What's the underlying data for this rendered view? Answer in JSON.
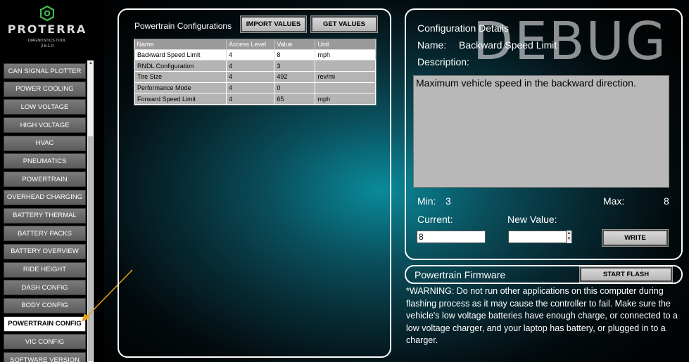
{
  "sidebar": {
    "brand": "PROTERRA",
    "tool_name": "DIAGNOSTICS TOOL",
    "version": "2.6.1.0",
    "items": [
      {
        "label": "CAN SIGNAL PLOTTER"
      },
      {
        "label": "POWER COOLING"
      },
      {
        "label": "LOW VOLTAGE"
      },
      {
        "label": "HIGH VOLTAGE"
      },
      {
        "label": "HVAC"
      },
      {
        "label": "PNEUMATICS"
      },
      {
        "label": "POWERTRAIN"
      },
      {
        "label": "OVERHEAD CHARGING"
      },
      {
        "label": "BATTERY THERMAL"
      },
      {
        "label": "BATTERY PACKS"
      },
      {
        "label": "BATTERY OVERVIEW"
      },
      {
        "label": "RIDE HEIGHT"
      },
      {
        "label": "DASH CONFIG"
      },
      {
        "label": "BODY CONFIG"
      },
      {
        "label": "POWERTRAIN CONFIG"
      },
      {
        "label": "VIC CONFIG"
      },
      {
        "label": "SOFTWARE VERSION"
      }
    ],
    "active_index": 14
  },
  "config_panel": {
    "title": "Powertrain Configurations",
    "import_label": "IMPORT VALUES",
    "get_label": "GET VALUES",
    "columns": [
      "Name",
      "Access Level",
      "Value",
      "Unit"
    ],
    "rows": [
      [
        "Backward Speed Limit",
        "4",
        "8",
        "mph"
      ],
      [
        "RNDL Configuration",
        "4",
        "3",
        ""
      ],
      [
        "Tire Size",
        "4",
        "492",
        "rev/mi"
      ],
      [
        "Performance Mode",
        "4",
        "0",
        ""
      ],
      [
        "Forward Speed Limit",
        "4",
        "65",
        "mph"
      ]
    ],
    "selected_row": 0
  },
  "details": {
    "header": "Configuration Details",
    "watermark": "DEBUG",
    "name_label": "Name:",
    "name_value": "Backward Speed Limit",
    "description_label": "Description:",
    "description": "Maximum vehicle speed in the backward direction.",
    "min_label": "Min:",
    "min_value": "3",
    "max_label": "Max:",
    "max_value": "8",
    "current_label": "Current:",
    "current_value": "8",
    "new_value_label": "New Value:",
    "new_value": "",
    "write_label": "WRITE"
  },
  "firmware": {
    "title": "Powertrain Firmware",
    "flash_label": "START FLASH",
    "warning": "*WARNING: Do not run other applications on this computer during flashing process as it may cause the controller to fail. Make sure the vehicle's low voltage batteries have enough charge, or connected to a low voltage charger, and your laptop has battery, or plugged in to a charger."
  },
  "colors": {
    "logo_green": "#3fbf4a",
    "annotation_arrow": "#e8a317",
    "nav_gray": "#6a6a6a",
    "background_teal": "#0a8a9a"
  }
}
